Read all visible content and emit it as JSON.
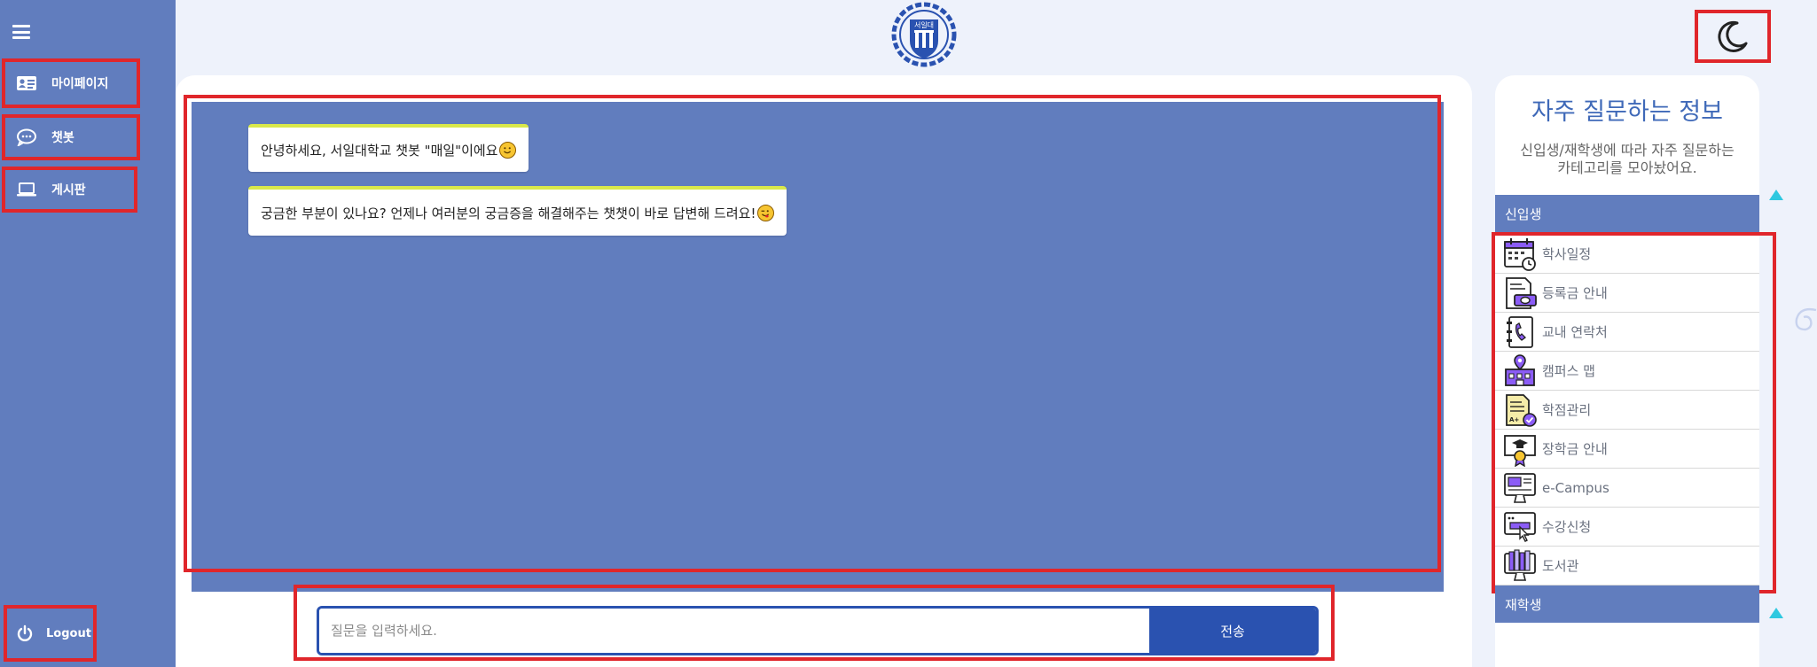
{
  "sidebar": {
    "items": [
      {
        "label": "마이페이지",
        "icon": "id-card-icon"
      },
      {
        "label": "챗봇",
        "icon": "chat-bubble-icon"
      },
      {
        "label": "게시판",
        "icon": "laptop-icon"
      }
    ],
    "logout": {
      "label": "Logout",
      "icon": "power-icon"
    }
  },
  "header": {
    "logo_text": "서일대",
    "theme_icon": "moon-icon"
  },
  "chat": {
    "messages": [
      {
        "text": "안녕하세요, 서일대학교 챗봇 \"매일\"이에요",
        "emoji": "smile-emoji"
      },
      {
        "text": "궁금한 부분이 있나요? 언제나 여러분의 궁금증을 해결해주는 챗챗이 바로 답변해 드려요!",
        "emoji": "wink-emoji"
      }
    ],
    "input_placeholder": "질문을 입력하세요.",
    "send_label": "전송"
  },
  "faq": {
    "title": "자주 질문하는 정보",
    "subtitle_line1": "신입생/재학생에 따라 자주 질문하는",
    "subtitle_line2": "카테고리를 모아놨어요.",
    "categories": [
      {
        "label": "신입생",
        "items": [
          {
            "label": "학사일정",
            "icon": "calendar-icon"
          },
          {
            "label": "등록금 안내",
            "icon": "invoice-icon"
          },
          {
            "label": "교내 연락처",
            "icon": "phone-book-icon"
          },
          {
            "label": "캠퍼스 맵",
            "icon": "campus-map-icon"
          },
          {
            "label": "학점관리",
            "icon": "grade-report-icon"
          },
          {
            "label": "장학금 안내",
            "icon": "scholarship-icon"
          },
          {
            "label": "e-Campus",
            "icon": "monitor-icon"
          },
          {
            "label": "수강신청",
            "icon": "registration-icon"
          },
          {
            "label": "도서관",
            "icon": "library-icon"
          }
        ]
      },
      {
        "label": "재학생",
        "items": []
      }
    ]
  },
  "colors": {
    "sidebar": "#617dbe",
    "accent": "#2a52b0",
    "highlight": "#e0262b",
    "bubble_top": "#d9e84a",
    "arrow": "#2ec8e0"
  }
}
